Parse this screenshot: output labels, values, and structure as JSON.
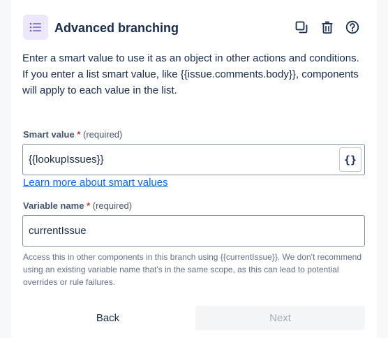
{
  "header": {
    "title": "Advanced branching",
    "icons": {
      "component": "list-icon",
      "duplicate": "duplicate-icon",
      "delete": "trash-icon",
      "help": "help-icon"
    }
  },
  "description": "Enter a smart value to use it as an object in other actions and conditions. If you enter a list smart value, like {{issue.comments.body}}, components will apply to each value in the list.",
  "smart_value": {
    "label": "Smart value",
    "required_star": "*",
    "required_text": "(required)",
    "value": "{{lookupIssues}}",
    "brace_button": "{}"
  },
  "learn_more_link": "Learn more about smart values",
  "variable_name": {
    "label": "Variable name",
    "required_star": "*",
    "required_text": "(required)",
    "value": "currentIssue"
  },
  "help_text": "Access this in other components in this branch using {{currentIssue}}. We don't recommend using an existing variable name that's in the same scope, as this can lead to potential overrides or rule failures.",
  "buttons": {
    "back": "Back",
    "next": "Next"
  },
  "colors": {
    "accent_bg": "#ede7fb",
    "accent_icon": "#6e5dc6",
    "link": "#0c66e4",
    "required": "#c9372c"
  }
}
